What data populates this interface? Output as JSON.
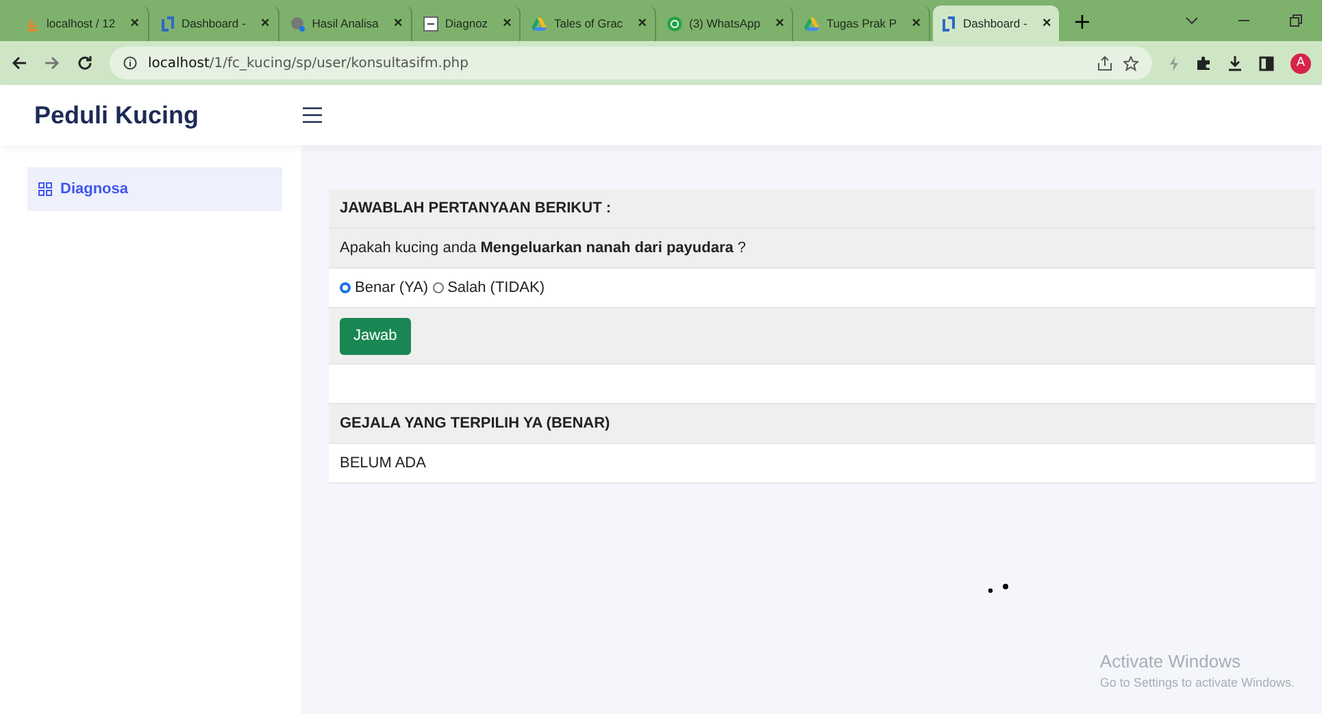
{
  "browser": {
    "tabs": [
      {
        "title": "localhost / 12",
        "kind": "sail",
        "selected": false
      },
      {
        "title": "Dashboard -",
        "kind": "bracket",
        "selected": false
      },
      {
        "title": "Hasil Analisa",
        "kind": "globe",
        "selected": false
      },
      {
        "title": "Diagnoz",
        "kind": "doc",
        "selected": false
      },
      {
        "title": "Tales of Grac",
        "kind": "triangle",
        "selected": false
      },
      {
        "title": "(3) WhatsApp",
        "kind": "chat",
        "selected": false
      },
      {
        "title": "Tugas Prak P",
        "kind": "triangle",
        "selected": false
      },
      {
        "title": "Dashboard -",
        "kind": "bracket",
        "selected": true
      }
    ],
    "close_glyph": "×",
    "new_tab_glyph": "+",
    "url_host": "localhost",
    "url_path": "/1/fc_kucing/sp/user/konsultasifm.php",
    "profile_initial": "A"
  },
  "app": {
    "brand": "Peduli Kucing",
    "sidebar": {
      "items": [
        {
          "label": "Diagnosa",
          "selected": true
        }
      ]
    }
  },
  "question_card": {
    "heading": "JAWABLAH PERTANYAAN BERIKUT :",
    "question": "Apakah kucing anda **Mengeluarkan nanah dari payudara** ?",
    "options": [
      {
        "label": "Benar (YA)",
        "selected": true
      },
      {
        "label": "Salah (TIDAK)",
        "selected": false
      }
    ],
    "submit": "Jawab"
  },
  "result_card": {
    "heading": "GEJALA YANG TERPILIH YA (BENAR)",
    "body": "BELUM ADA"
  },
  "watermark": {
    "title": "Activate Windows",
    "subtitle": "Go to Settings to activate Windows."
  }
}
